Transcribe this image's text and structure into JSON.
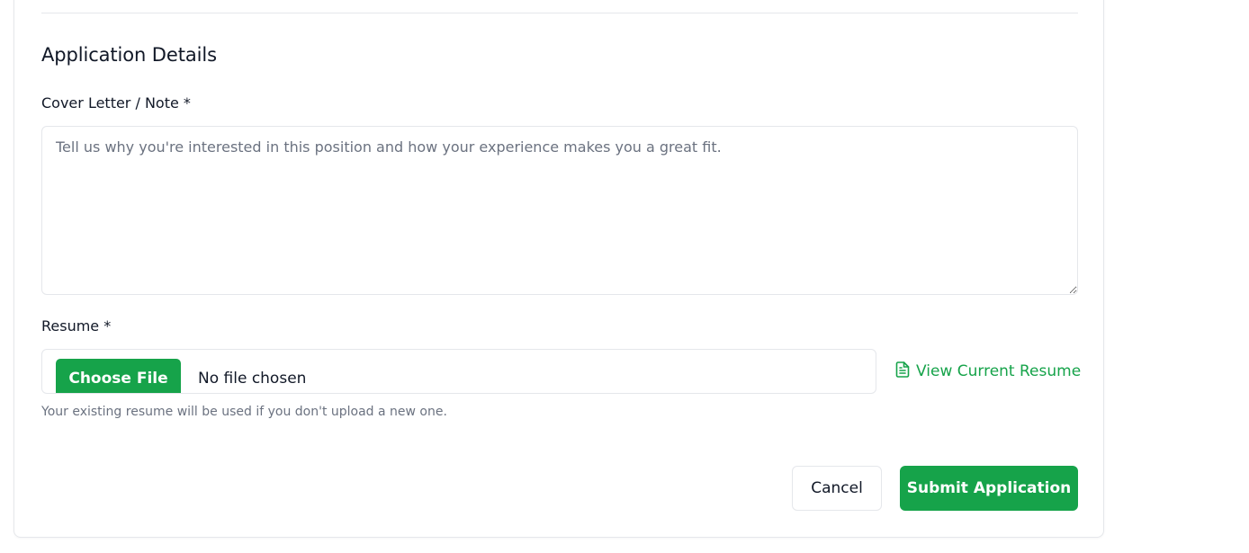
{
  "section": {
    "title": "Application Details"
  },
  "cover_letter": {
    "label": "Cover Letter / Note *",
    "value": "",
    "placeholder": "Tell us why you're interested in this position and how your experience makes you a great fit."
  },
  "resume": {
    "label": "Resume *",
    "choose_file_label": "Choose File",
    "file_status": "No file chosen",
    "view_link_label": "View Current Resume",
    "view_link_icon": "file-text-icon",
    "help_text": "Your existing resume will be used if you don't upload a new one."
  },
  "actions": {
    "cancel_label": "Cancel",
    "submit_label": "Submit Application"
  },
  "colors": {
    "accent": "#16a34a",
    "border": "#e5e7eb",
    "muted_text": "#6b7280"
  }
}
